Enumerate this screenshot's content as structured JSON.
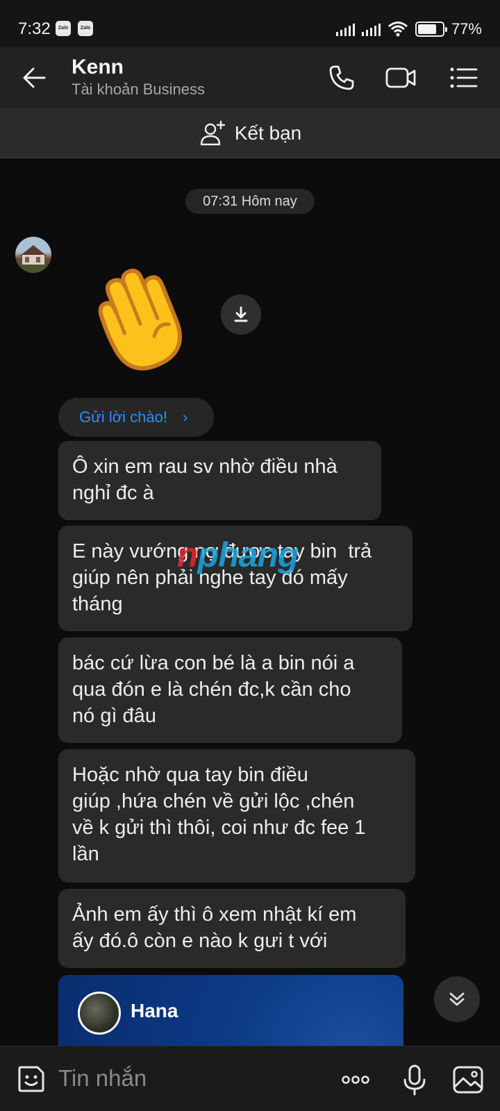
{
  "status_bar": {
    "time": "7:32",
    "app_badge": "Zalo",
    "battery": "77%",
    "battery_level": 0.77
  },
  "header": {
    "title": "Kenn",
    "subtitle": "Tài khoản Business"
  },
  "add_friend": {
    "label": "Kết bạn"
  },
  "chat": {
    "timestamp": "07:31 Hôm nay",
    "greet_label": "Gửi lời chào!",
    "messages": [
      "Ô xin em rau sv nhờ điều nhà\nnghỉ đc à",
      "E này vướng nợ được tay bin  trả\ngiúp nên phải nghe tay đó mấy\ntháng",
      "bác cứ lừa con bé là a bin nói a\nqua đón e là chén đc,k cần cho\nnó gì đâu",
      "Hoặc nhờ qua tay bin điều\ngiúp ,hứa chén về gửi lộc ,chén\nvề k gửi thì thôi, coi như đc fee 1\nlần",
      "Ảnh em ấy thì ô xem nhật kí em\nấy đó.ô còn e nào k gưi t với"
    ],
    "contact_card": {
      "name": "Hana"
    }
  },
  "watermark": {
    "part1": "n",
    "part2": "phang"
  },
  "input": {
    "placeholder": "Tin nhắn"
  },
  "colors": {
    "accent": "#2f8cff",
    "bubble": "#2a2a2a",
    "header": "#222222",
    "background": "#0c0c0c"
  }
}
